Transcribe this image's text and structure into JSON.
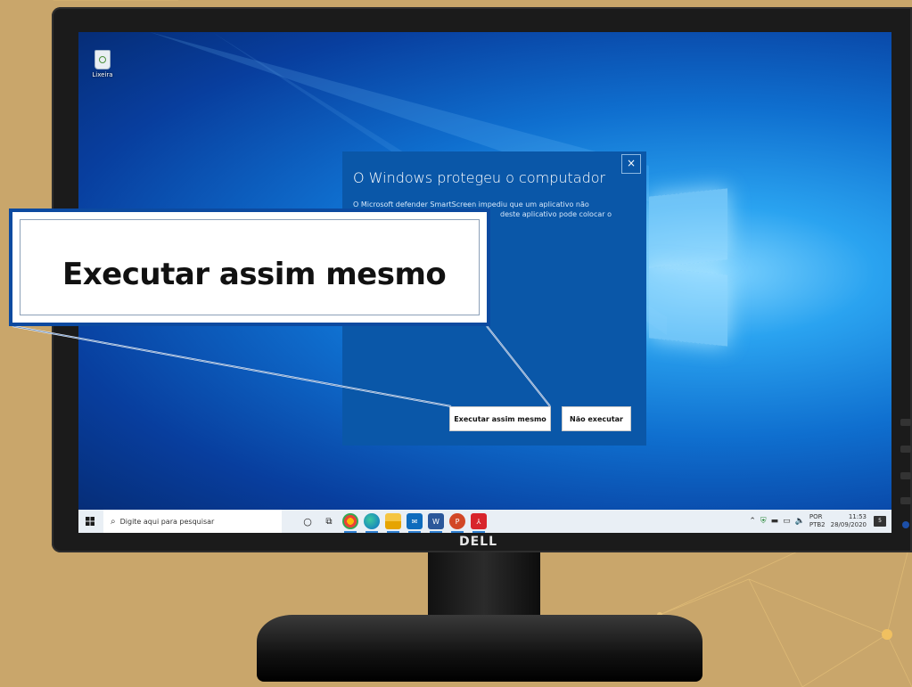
{
  "desktop": {
    "recycle_bin_label": "Lixeira"
  },
  "dialog": {
    "title": "O Windows protegeu o computador",
    "body_line1": "O Microsoft defender SmartScreen impediu que um aplicativo não",
    "body_line2": "deste aplicativo pode colocar o",
    "close_glyph": "×",
    "run_anyway_label": "Executar assim mesmo",
    "dont_run_label": "Não executar"
  },
  "callout": {
    "text": "Executar assim mesmo"
  },
  "taskbar": {
    "search_placeholder": "Digite aqui para pesquisar",
    "apps": [
      "cortana-icon",
      "task-view-icon",
      "chrome-icon",
      "edge-icon",
      "file-explorer-icon",
      "mail-icon",
      "word-icon",
      "powerpoint-icon",
      "acrobat-icon"
    ],
    "tray": {
      "lang_top": "POR",
      "lang_bottom": "PTB2",
      "time": "11:53",
      "date": "28/09/2020",
      "notification_count": "5"
    }
  },
  "monitor": {
    "brand": "DELL"
  },
  "colors": {
    "dialog_bg": "#0a57a8",
    "callout_border": "#0c4aa0",
    "background": "#c9a66b"
  }
}
